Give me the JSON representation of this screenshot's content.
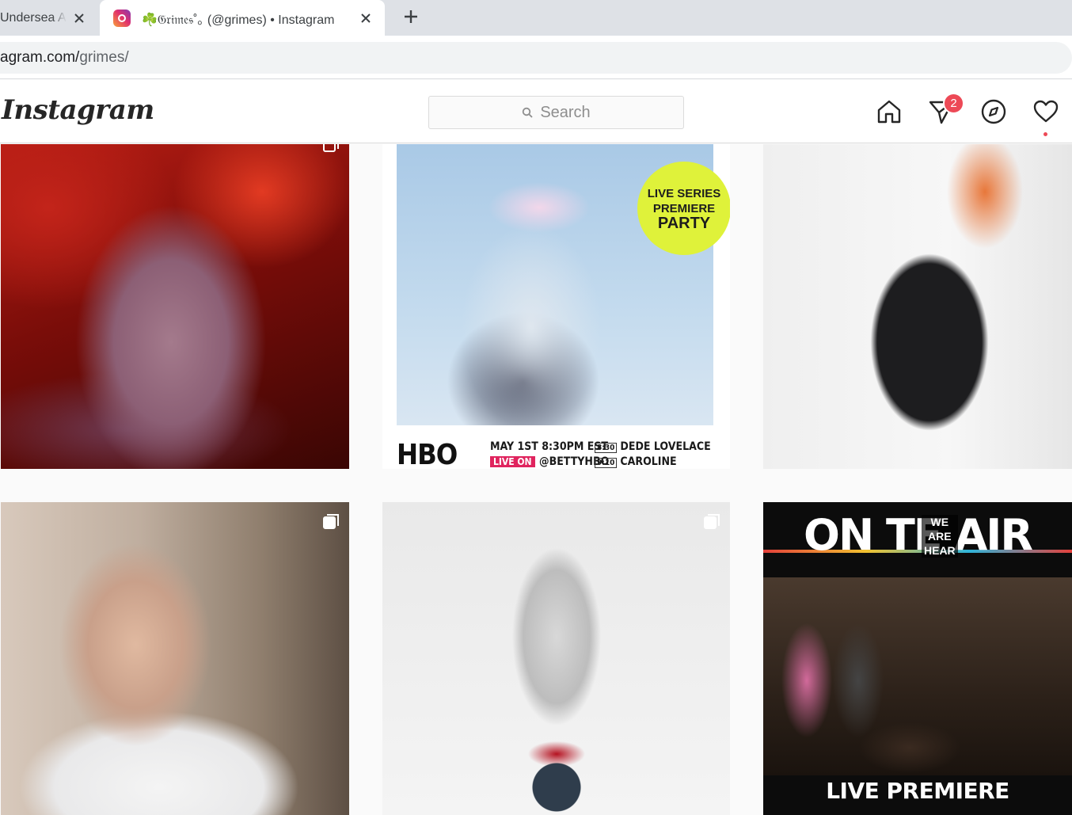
{
  "browser": {
    "tabs": [
      {
        "title": "Undersea A",
        "active": false
      },
      {
        "title": "☘️𝔊𝔯𝔦𝔪𝔢𝔰˚｡ (@grimes) • Instagram",
        "active": true
      }
    ],
    "new_tab_glyph": "+",
    "url": {
      "host": "agram.com/",
      "path": "grimes/"
    }
  },
  "header": {
    "logo": "Instagram",
    "search_placeholder": "Search",
    "notifications_count": "2",
    "icons": [
      "home-icon",
      "direct-icon",
      "explore-icon",
      "activity-icon"
    ]
  },
  "posts": [
    {
      "id": "red-cave-portrait"
    },
    {
      "id": "hbo-poster",
      "sticker": [
        "LIVE SERIES",
        "PREMIERE",
        "PARTY"
      ],
      "network": "HBO",
      "date": "MAY 1ST 8:30PM EST",
      "live_on": "LIVE ON",
      "handle": "@BETTYHBO",
      "times": [
        "8:30",
        "9:10"
      ],
      "performers": [
        "DEDE LOVELACE",
        "CAROLINE POLACHEK"
      ]
    },
    {
      "id": "studio-kneeling"
    },
    {
      "id": "selfie-headpiece"
    },
    {
      "id": "silver-angel-art"
    },
    {
      "id": "on-the-air",
      "title_left": "ON T",
      "title_overlay": [
        "WE",
        "ARE",
        "HEAR"
      ],
      "title_right": "E AIR",
      "subtitle": "LIVE PREMIERE"
    }
  ],
  "colors": {
    "badge": "#ed4956",
    "tabstrip": "#dee1e6"
  }
}
